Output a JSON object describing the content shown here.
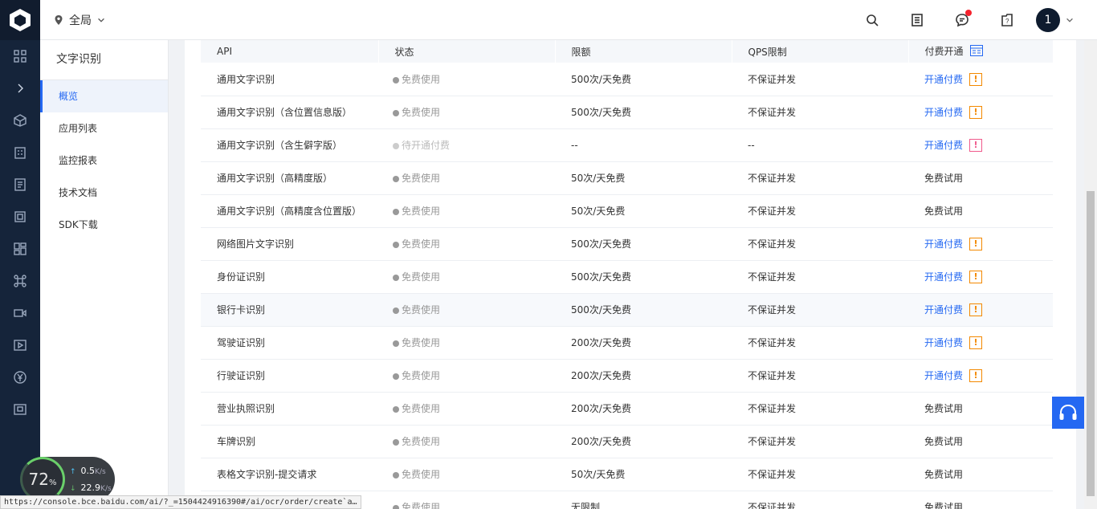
{
  "topbar": {
    "region_label": "全局",
    "avatar_text": "1"
  },
  "subnav": {
    "title": "文字识别",
    "items": [
      {
        "label": "概览",
        "active": true
      },
      {
        "label": "应用列表"
      },
      {
        "label": "监控报表"
      },
      {
        "label": "技术文档"
      },
      {
        "label": "SDK下载"
      }
    ]
  },
  "table": {
    "headers": [
      "API",
      "状态",
      "限额",
      "QPS限制",
      "付费开通"
    ],
    "rows": [
      {
        "api": "通用文字识别",
        "status": "免费使用",
        "quota": "500次/天免费",
        "qps": "不保证并发",
        "action": "开通付费",
        "action_type": "link",
        "warn": "orange"
      },
      {
        "api": "通用文字识别（含位置信息版）",
        "status": "免费使用",
        "quota": "500次/天免费",
        "qps": "不保证并发",
        "action": "开通付费",
        "action_type": "link",
        "warn": "orange"
      },
      {
        "api": "通用文字识别（含生僻字版）",
        "status": "待开通付费",
        "quota": "--",
        "qps": "--",
        "action": "开通付费",
        "action_type": "link",
        "warn": "pink",
        "pending": true
      },
      {
        "api": "通用文字识别（高精度版）",
        "status": "免费使用",
        "quota": "50次/天免费",
        "qps": "不保证并发",
        "action": "免费试用",
        "action_type": "text"
      },
      {
        "api": "通用文字识别（高精度含位置版）",
        "status": "免费使用",
        "quota": "50次/天免费",
        "qps": "不保证并发",
        "action": "免费试用",
        "action_type": "text"
      },
      {
        "api": "网络图片文字识别",
        "status": "免费使用",
        "quota": "500次/天免费",
        "qps": "不保证并发",
        "action": "开通付费",
        "action_type": "link",
        "warn": "orange"
      },
      {
        "api": "身份证识别",
        "status": "免费使用",
        "quota": "500次/天免费",
        "qps": "不保证并发",
        "action": "开通付费",
        "action_type": "link",
        "warn": "orange"
      },
      {
        "api": "银行卡识别",
        "status": "免费使用",
        "quota": "500次/天免费",
        "qps": "不保证并发",
        "action": "开通付费",
        "action_type": "link",
        "warn": "orange",
        "highlight": true
      },
      {
        "api": "驾驶证识别",
        "status": "免费使用",
        "quota": "200次/天免费",
        "qps": "不保证并发",
        "action": "开通付费",
        "action_type": "link",
        "warn": "orange"
      },
      {
        "api": "行驶证识别",
        "status": "免费使用",
        "quota": "200次/天免费",
        "qps": "不保证并发",
        "action": "开通付费",
        "action_type": "link",
        "warn": "orange"
      },
      {
        "api": "营业执照识别",
        "status": "免费使用",
        "quota": "200次/天免费",
        "qps": "不保证并发",
        "action": "免费试用",
        "action_type": "text"
      },
      {
        "api": "车牌识别",
        "status": "免费使用",
        "quota": "200次/天免费",
        "qps": "不保证并发",
        "action": "免费试用",
        "action_type": "text"
      },
      {
        "api": "表格文字识别-提交请求",
        "status": "免费使用",
        "quota": "50次/天免费",
        "qps": "不保证并发",
        "action": "免费试用",
        "action_type": "text"
      },
      {
        "api": "",
        "status": "免费使用",
        "quota": "无限制",
        "qps": "不保证并发",
        "action": "免费试用",
        "action_type": "text"
      }
    ],
    "warn_glyph": "!"
  },
  "speed_widget": {
    "percent": "72",
    "percent_symbol": "%",
    "up_rate": "0.5",
    "down_rate": "22.9",
    "unit": "K/s",
    "up_arrow": "↑",
    "down_arrow": "↓"
  },
  "statusbar": {
    "url": "https://console.bce.baidu.com/ai/?_=1504424916390#/ai/ocr/order/create`a…"
  },
  "colors": {
    "rail_bg": "#15243a",
    "accent": "#2468f2",
    "warn_orange": "#f38900",
    "warn_pink": "#f05a8c"
  },
  "icons": {
    "rail": [
      "logo-icon",
      "grid-icon",
      "expand-icon",
      "cube-icon",
      "building-icon",
      "document-icon",
      "layers-icon",
      "dashboard-icon",
      "command-icon",
      "video-icon",
      "play-icon",
      "yuan-icon",
      "monitor-icon"
    ],
    "top": [
      "search-icon",
      "list-icon",
      "message-icon",
      "help-icon",
      "chevron-down-icon"
    ]
  }
}
